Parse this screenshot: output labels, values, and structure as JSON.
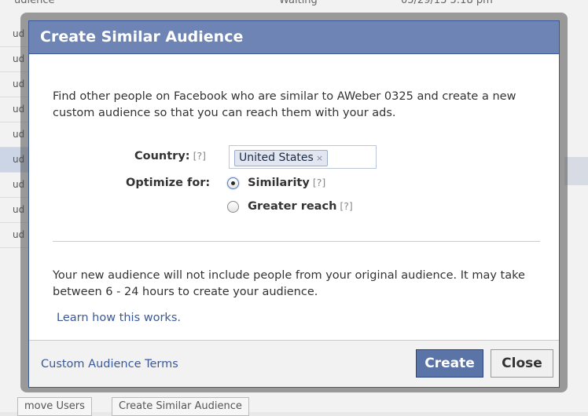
{
  "background": {
    "top_row": [
      "udience",
      "Waiting",
      "05/29/13 5:18 pm"
    ],
    "row_labels": [
      "ud",
      "ud",
      "ud",
      "ud",
      "ud",
      "ud",
      "ud",
      "ud",
      "ud"
    ],
    "bottom_buttons": [
      "move Users",
      "Create Similar Audience"
    ]
  },
  "dialog": {
    "title": "Create Similar Audience",
    "intro": "Find other people on Facebook who are similar to AWeber 0325 and create a new custom audience so that you can reach them with your ads.",
    "country_label": "Country:",
    "help": "[?]",
    "country_value": "United States",
    "token_remove": "×",
    "optimize_label": "Optimize for:",
    "options": [
      {
        "label": "Similarity",
        "checked": true
      },
      {
        "label": "Greater reach",
        "checked": false
      }
    ],
    "note": "Your new audience will not include people from your original audience. It may take between 6 - 24 hours to create your audience.",
    "learn_link": "Learn how this works.",
    "terms_link": "Custom Audience Terms",
    "create_button": "Create",
    "close_button": "Close"
  }
}
